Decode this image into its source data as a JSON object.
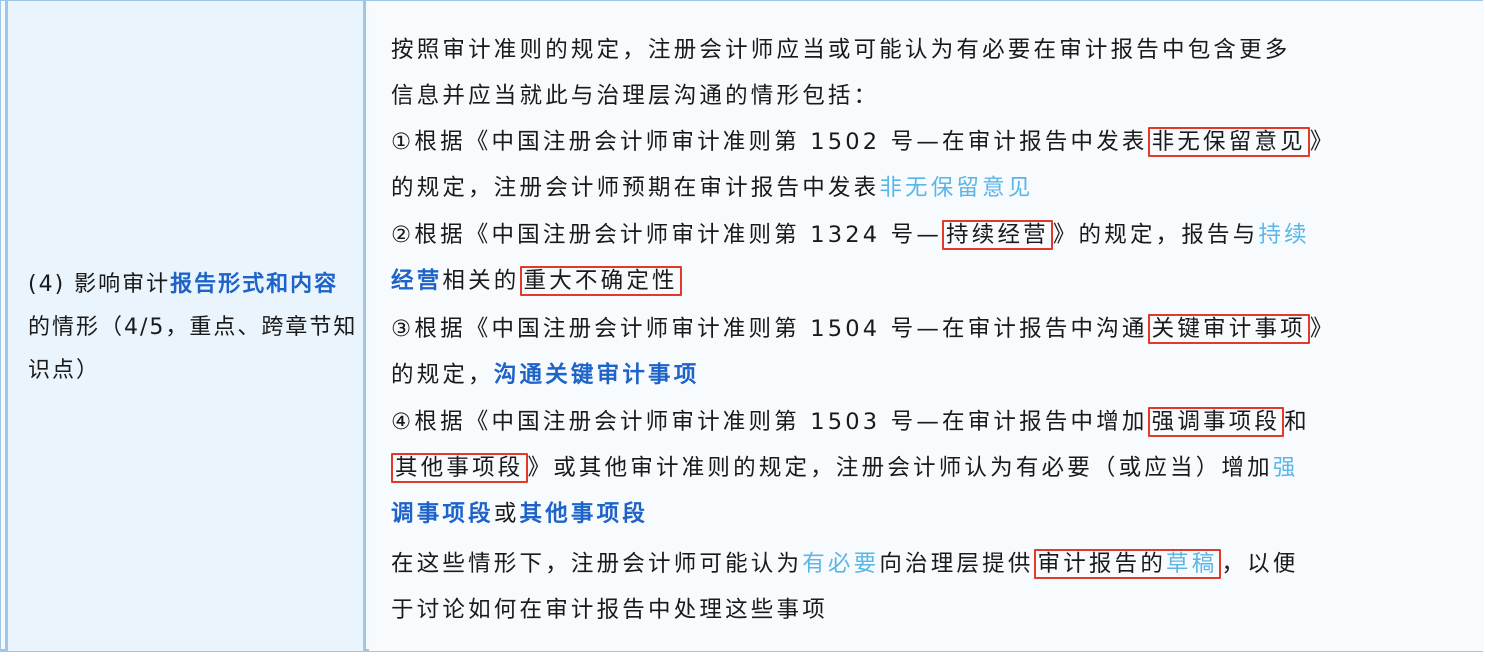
{
  "left": {
    "prefix": "(4) 影响审计",
    "highlight": "报告形式和内容",
    "suffix": "的情形（4/5，重点、跨章节知识点）"
  },
  "right": {
    "intro_l1": "按照审计准则的规定，注册会计师应当或可能认为有必要在审计报告中包含更多",
    "intro_l2": "信息并应当就此与治理层沟通的情形包括：",
    "i1_a": "①根据《中国注册会计师审计准则第 1502 号—在审计报告中发表",
    "i1_box": "非无保留意见",
    "i1_end": "》",
    "i1_b": "的规定，注册会计师预期在审计报告中发表",
    "i1_hl": "非无保留意见",
    "i2_a": "②根据《中国注册会计师审计准则第 1324 号—",
    "i2_box": "持续经营",
    "i2_mid": "》的规定，报告与",
    "i2_hl1": "持续",
    "i2_hl2": "经营",
    "i2_c": "相关的",
    "i2_box2": "重大不确定性",
    "i3_a": "③根据《中国注册会计师审计准则第 1504 号—在审计报告中沟通",
    "i3_box": "关键审计事项",
    "i3_end": "》",
    "i3_b": "的规定，",
    "i3_hl": "沟通关键审计事项",
    "i4_a": "④根据《中国注册会计师审计准则第 1503 号—在审计报告中增加",
    "i4_box": "强调事项段",
    "i4_and": "和",
    "i4_box2": "其他事项段",
    "i4_b": "》或其他审计准则的规定，注册会计师认为有必要（或应当）增加",
    "i4_hl1": "强",
    "i4_hl2": "调事项段",
    "i4_or": "或",
    "i4_hl3": "其他事项段",
    "f_a": "在这些情形下，注册会计师可能认为",
    "f_hl": "有必要",
    "f_b": "向治理层提供",
    "f_box": "审计报告的",
    "f_box_hl": "草稿",
    "f_c": "，以便",
    "f_l2": "于讨论如何在审计报告中处理这些事项"
  }
}
